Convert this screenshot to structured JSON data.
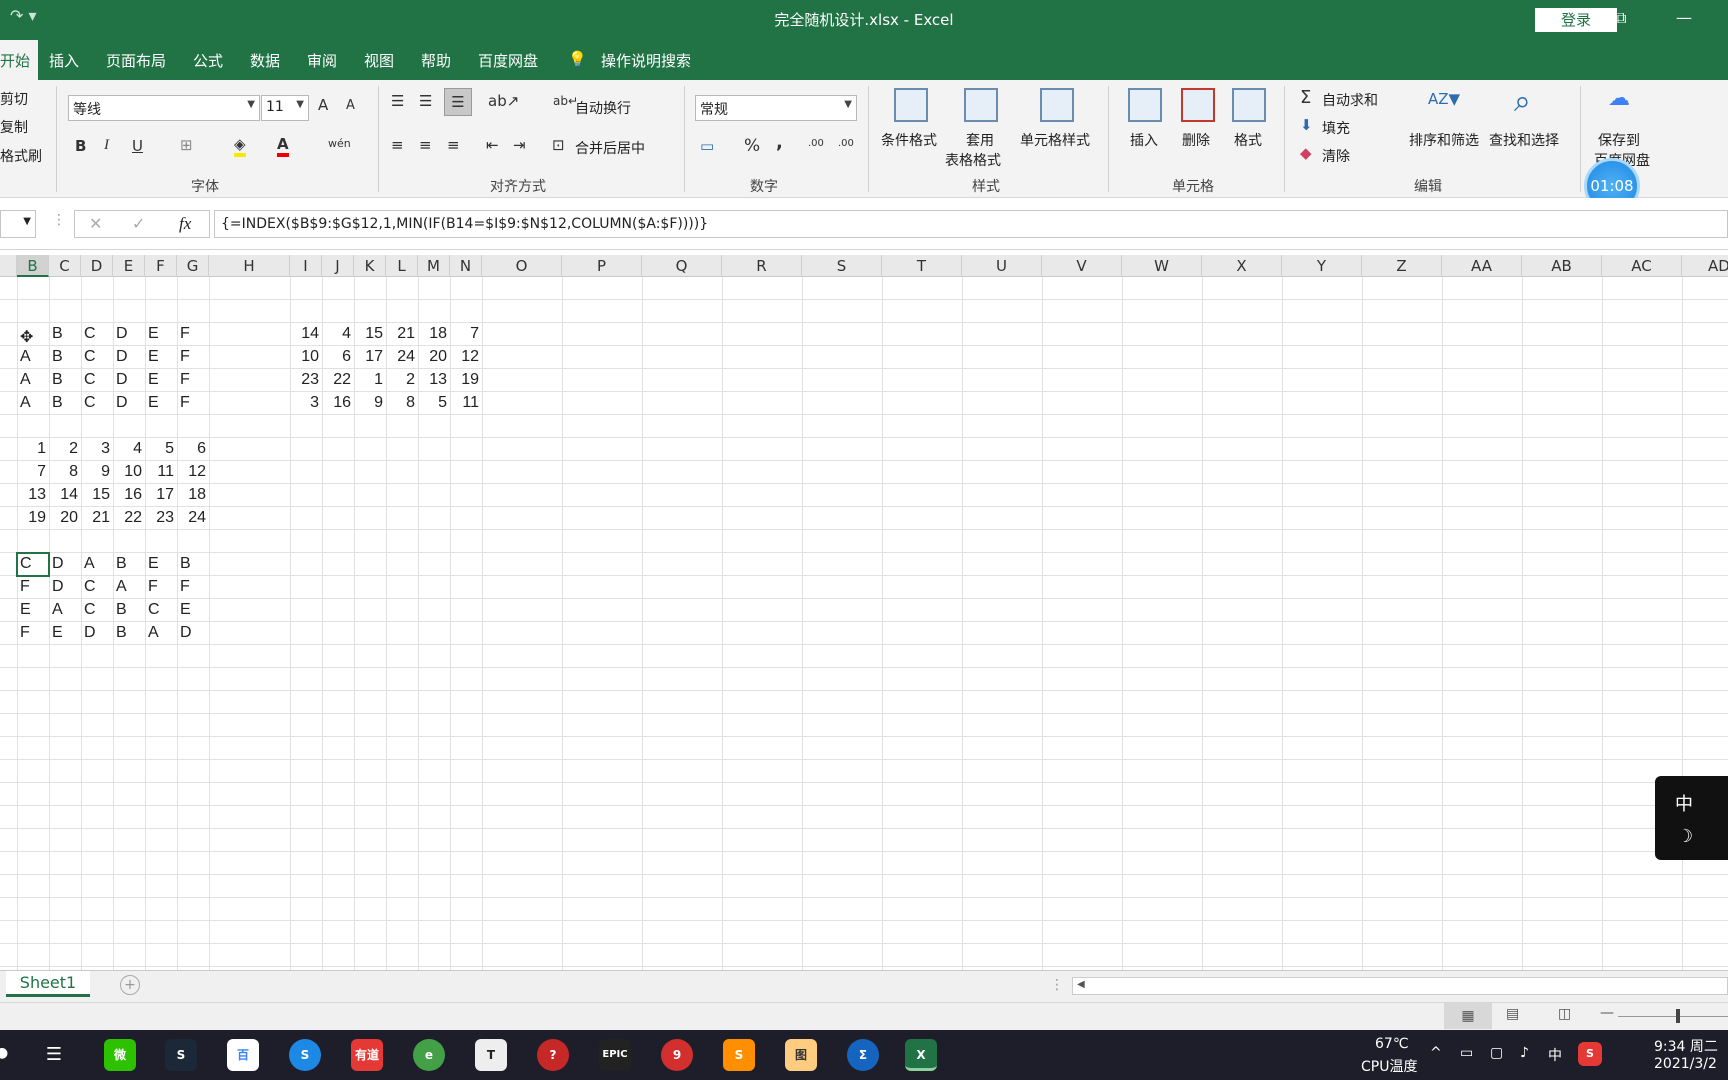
{
  "window": {
    "title": "完全随机设计.xlsx  -  Excel",
    "login_label": "登录",
    "restore_glyph": "⧉",
    "minimize_glyph": "—",
    "qat_glyph": "↷ ▾"
  },
  "tabs": [
    "开始",
    "插入",
    "页面布局",
    "公式",
    "数据",
    "审阅",
    "视图",
    "帮助",
    "百度网盘"
  ],
  "tell_me": "操作说明搜索",
  "clipboard": {
    "cut": "剪切",
    "copy": "复制",
    "format_painter": "格式刷"
  },
  "font": {
    "name": "等线",
    "size": "11",
    "group_label": "字体",
    "bold": "B",
    "italic": "I",
    "underline": "U",
    "grow": "A",
    "shrink": "A",
    "pinyin": "wén"
  },
  "alignment": {
    "wrap": "自动换行",
    "merge": "合并后居中",
    "group_label": "对齐方式"
  },
  "number": {
    "format": "常规",
    "percent": "%",
    "comma": ",",
    "group_label": "数字",
    "inc_decimal": ".00",
    "dec_decimal": ".00"
  },
  "styles": {
    "conditional": "条件格式",
    "table_1": "套用",
    "table_2": "表格格式",
    "cell_styles": "单元格样式",
    "group_label": "样式"
  },
  "cells": {
    "insert": "插入",
    "delete": "删除",
    "format": "格式",
    "group_label": "单元格"
  },
  "editing": {
    "autosum": "自动求和",
    "fill": "填充",
    "clear": "清除",
    "sort_filter": "排序和筛选",
    "find_select": "查找和选择",
    "group_label": "编辑"
  },
  "save_to": {
    "line1": "保存到",
    "line2": "百度网盘"
  },
  "timer": "01:08",
  "formula_bar": {
    "cancel": "✕",
    "confirm": "✓",
    "fx": "fx",
    "formula": "{=INDEX($B$9:$G$12,1,MIN(IF(B14=$I$9:$N$12,COLUMN($A:$F))))}"
  },
  "columns": [
    "B",
    "C",
    "D",
    "E",
    "F",
    "G",
    "H",
    "I",
    "J",
    "K",
    "L",
    "M",
    "N",
    "O",
    "P",
    "Q",
    "R",
    "S",
    "T",
    "U",
    "V",
    "W",
    "X",
    "Y",
    "Z",
    "AA",
    "AB",
    "AC",
    "AD"
  ],
  "selected_column": "B",
  "block_letters": [
    [
      "",
      "B",
      "C",
      "D",
      "E",
      "F"
    ],
    [
      "A",
      "B",
      "C",
      "D",
      "E",
      "F"
    ],
    [
      "A",
      "B",
      "C",
      "D",
      "E",
      "F"
    ],
    [
      "A",
      "B",
      "C",
      "D",
      "E",
      "F"
    ]
  ],
  "block_random": [
    [
      "14",
      "4",
      "15",
      "21",
      "18",
      "7"
    ],
    [
      "10",
      "6",
      "17",
      "24",
      "20",
      "12"
    ],
    [
      "23",
      "22",
      "1",
      "2",
      "13",
      "19"
    ],
    [
      "3",
      "16",
      "9",
      "8",
      "5",
      "11"
    ]
  ],
  "block_sequence": [
    [
      "1",
      "2",
      "3",
      "4",
      "5",
      "6"
    ],
    [
      "7",
      "8",
      "9",
      "10",
      "11",
      "12"
    ],
    [
      "13",
      "14",
      "15",
      "16",
      "17",
      "18"
    ],
    [
      "19",
      "20",
      "21",
      "22",
      "23",
      "24"
    ]
  ],
  "block_result": [
    [
      "C",
      "D",
      "A",
      "B",
      "E",
      "B"
    ],
    [
      "F",
      "D",
      "C",
      "A",
      "F",
      "F"
    ],
    [
      "E",
      "A",
      "C",
      "B",
      "C",
      "E"
    ],
    [
      "F",
      "E",
      "D",
      "B",
      "A",
      "D"
    ]
  ],
  "sheet": {
    "tab": "Sheet1",
    "add": "+"
  },
  "ime": {
    "mode": "中",
    "moon": "☽"
  },
  "taskbar": {
    "icons": [
      "☰",
      "微",
      "S",
      "百",
      "S",
      "有道",
      "e",
      "T",
      "?",
      "EPIC",
      "9",
      "S",
      "图",
      "Σ",
      "X"
    ],
    "temp": "67℃",
    "temp_label": "CPU温度",
    "lang": "中",
    "time": "9:34 周二",
    "date": "2021/3/2"
  }
}
